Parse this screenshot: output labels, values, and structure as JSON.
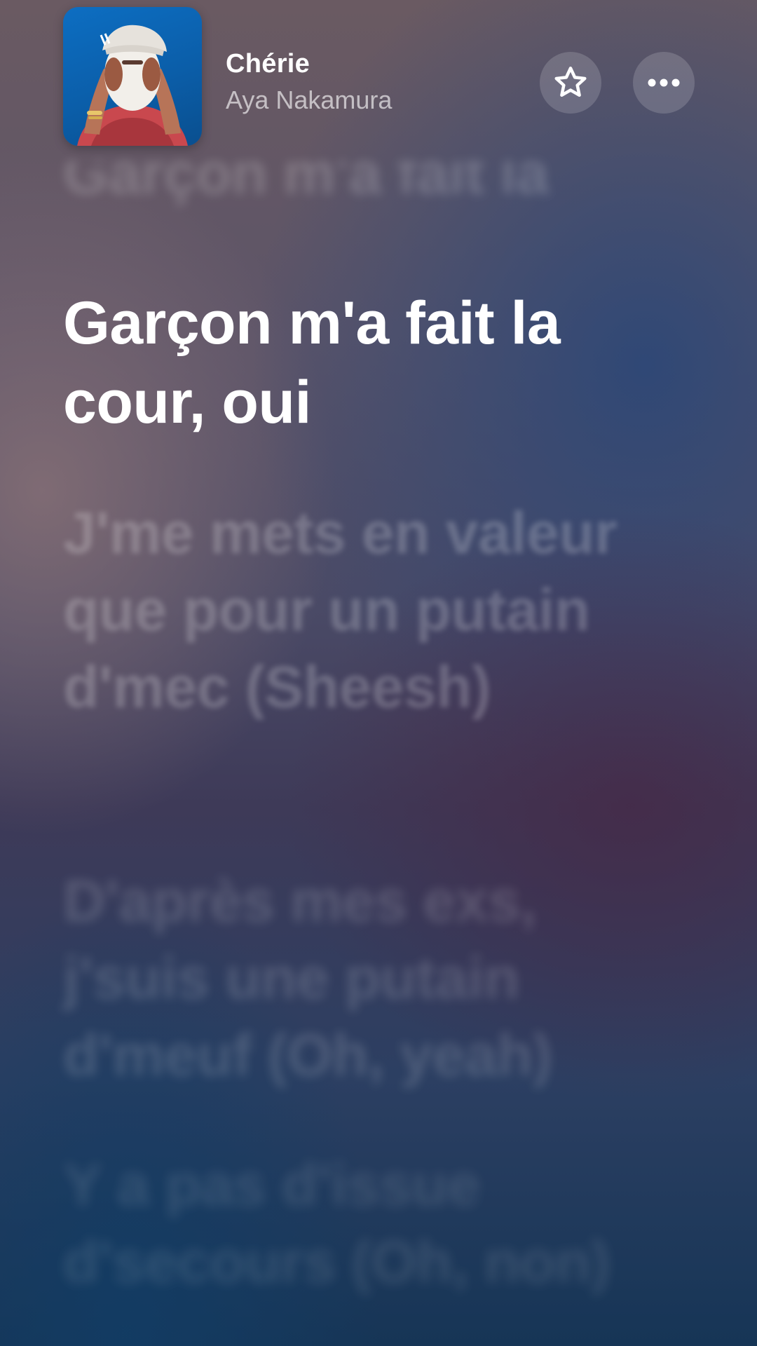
{
  "header": {
    "song_title": "Chérie",
    "artist": "Aya Nakamura",
    "album_art_icon": "album-art",
    "favorite_icon": "star-outline-icon",
    "more_icon": "ellipsis-icon"
  },
  "lyrics": {
    "previous": "Garçon m'a fait la cour, oui",
    "current": "Garçon m'a fait la cour, oui",
    "upcoming": [
      "J'me mets en valeur que pour un putain d'mec (Sheesh)",
      "D'après mes exs, j'suis une putain d'meuf (Oh, yeah)",
      "Y a pas d'issue d'secours (Oh, non)"
    ]
  },
  "colors": {
    "current_lyric": "#ffffff",
    "album_background": "#0b5ea9"
  }
}
